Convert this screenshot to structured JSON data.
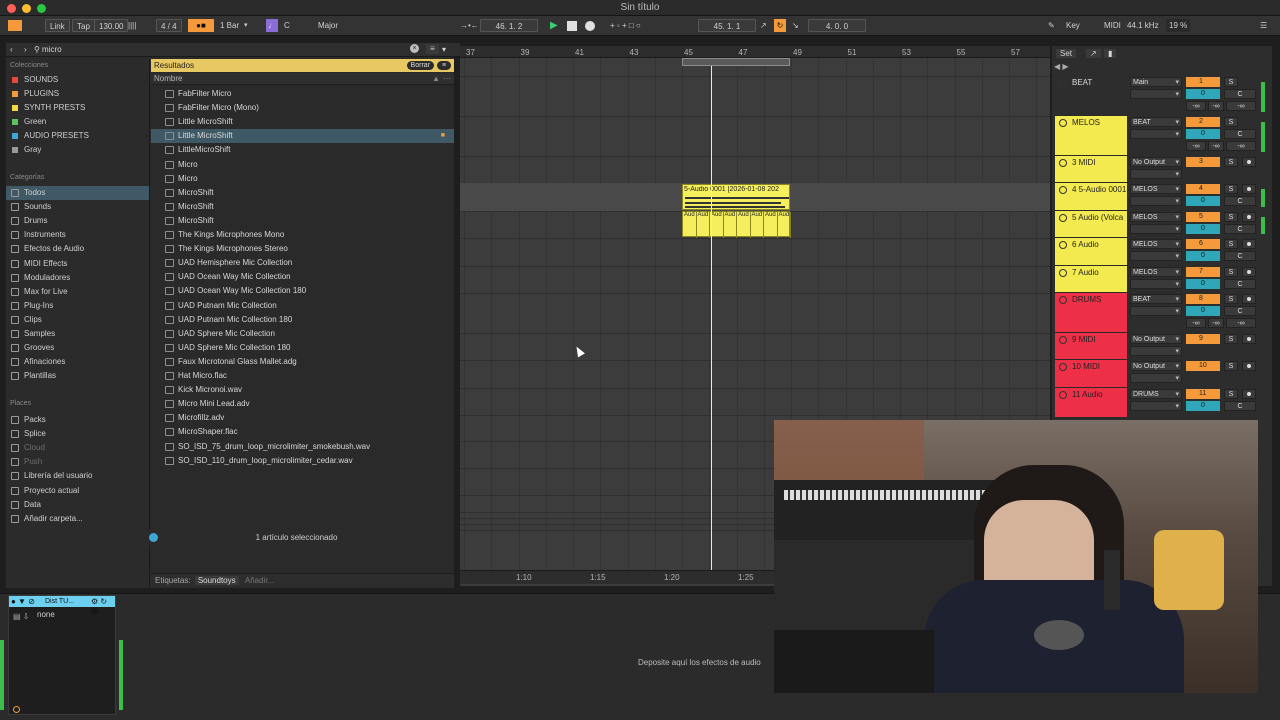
{
  "window": {
    "title": "Sin título"
  },
  "transport": {
    "link": "Link",
    "tap": "Tap",
    "tempo": "130.00",
    "signature": "4 / 4",
    "quantize": "1 Bar",
    "key": "C",
    "scale": "Major",
    "position": "46.  1.  2",
    "loop_start": "45.  1.  1",
    "loop_length": "4.  0.  0",
    "key_btn": "Key",
    "midi_btn": "MIDI",
    "sample_rate": "44.1 kHz",
    "cpu": "19 %"
  },
  "browser": {
    "search_value": "micro",
    "collections_title": "Colecciones",
    "collections": [
      {
        "label": "SOUNDS",
        "color": "#e84a3c"
      },
      {
        "label": "PLUGINS",
        "color": "#f59a3b"
      },
      {
        "label": "SYNTH PRESTS",
        "color": "#f0d84a"
      },
      {
        "label": "Green",
        "color": "#5cc45c"
      },
      {
        "label": "AUDIO PRESETS",
        "color": "#3fa7d6"
      },
      {
        "label": "Gray",
        "color": "#9a9a9a"
      }
    ],
    "categories_title": "Categorías",
    "categories": [
      "Todos",
      "Sounds",
      "Drums",
      "Instruments",
      "Efectos de Audio",
      "MIDI Effects",
      "Moduladores",
      "Max for Live",
      "Plug-Ins",
      "Clips",
      "Samples",
      "Grooves",
      "Afinaciones",
      "Plantillas"
    ],
    "places_title": "Places",
    "places": [
      "Packs",
      "Splice",
      "Cloud",
      "Push",
      "Librería del usuario",
      "Proyecto actual",
      "Data",
      "Añadir carpeta..."
    ],
    "results_title": "Resultados",
    "clear_label": "Borrar",
    "column_name": "Nombre",
    "results": [
      "FabFilter Micro",
      "FabFilter Micro (Mono)",
      "Little MicroShift",
      "Little MicroShift",
      "LittleMicroShift",
      "Micro",
      "Micro",
      "MicroShift",
      "MicroShift",
      "MicroShift",
      "The Kings Microphones Mono",
      "The Kings Microphones Stereo",
      "UAD Hemisphere Mic Collection",
      "UAD Ocean Way Mic Collection",
      "UAD Ocean Way Mic Collection 180",
      "UAD Putnam Mic Collection",
      "UAD Putnam Mic Collection 180",
      "UAD Sphere Mic Collection",
      "UAD Sphere Mic Collection 180",
      "Faux Microtonal Glass Mallet.adg",
      "Hat Micro.flac",
      "Kick Micronoi.wav",
      "Micro Mini Lead.adv",
      "Microfillz.adv",
      "MicroShaper.flac",
      "SO_ISD_75_drum_loop_microlimiter_smokebush.wav",
      "SO_ISD_110_drum_loop_microlimiter_cedar.wav"
    ],
    "selected_index": 3,
    "tags_label": "Etiquetas:",
    "tag_value": "Soundtoys",
    "tag_add": "Añadir...",
    "status": "1 artículo seleccionado"
  },
  "arrangement": {
    "bars": [
      "37",
      "39",
      "41",
      "43",
      "45",
      "47",
      "49",
      "51",
      "53",
      "55",
      "57"
    ],
    "clip_name": "5-Audio 0001 [2026-01-08 202",
    "subclip_label": "Aud",
    "time_marks": [
      "1:10",
      "1:15",
      "1:20",
      "1:25"
    ]
  },
  "mixer": {
    "set_label": "Set",
    "tracks": [
      {
        "name": "BEAT",
        "routing": "Main",
        "num": "1",
        "vol": "0",
        "pan": "C",
        "inf1": "-∞",
        "inf2": "-∞",
        "inf3": "-∞",
        "color": "#2d2d2d"
      },
      {
        "name": "MELOS",
        "routing": "BEAT",
        "num": "2",
        "vol": "0",
        "pan": "C",
        "inf1": "-∞",
        "inf2": "-∞",
        "inf3": "-∞",
        "color": "#f3ea4f"
      },
      {
        "name": "3 MIDI",
        "routing": "No Output",
        "num": "3",
        "color": "#f3ea4f"
      },
      {
        "name": "4 5-Audio 0001",
        "routing": "MELOS",
        "num": "4",
        "vol": "0",
        "pan": "C",
        "color": "#f3ea4f"
      },
      {
        "name": "5 Audio (Volca",
        "routing": "MELOS",
        "num": "5",
        "vol": "0",
        "pan": "C",
        "color": "#f3ea4f"
      },
      {
        "name": "6 Audio",
        "routing": "MELOS",
        "num": "6",
        "vol": "0",
        "pan": "C",
        "color": "#f3ea4f"
      },
      {
        "name": "7 Audio",
        "routing": "MELOS",
        "num": "7",
        "vol": "0",
        "pan": "C",
        "color": "#f3ea4f"
      },
      {
        "name": "DRUMS",
        "routing": "BEAT",
        "num": "8",
        "vol": "0",
        "pan": "C",
        "inf1": "-∞",
        "inf2": "-∞",
        "inf3": "-∞",
        "color": "#ee2f48"
      },
      {
        "name": "9 MIDI",
        "routing": "No Output",
        "num": "9",
        "color": "#ee2f48"
      },
      {
        "name": "10 MIDI",
        "routing": "No Output",
        "num": "10",
        "color": "#ee2f48"
      },
      {
        "name": "11 Audio",
        "routing": "DRUMS",
        "num": "11",
        "vol": "0",
        "pan": "C",
        "color": "#ee2f48"
      }
    ]
  },
  "devices": {
    "title": "Dist TU...",
    "preset": "none",
    "drop_hint": "Deposite aquí los efectos de audio"
  }
}
